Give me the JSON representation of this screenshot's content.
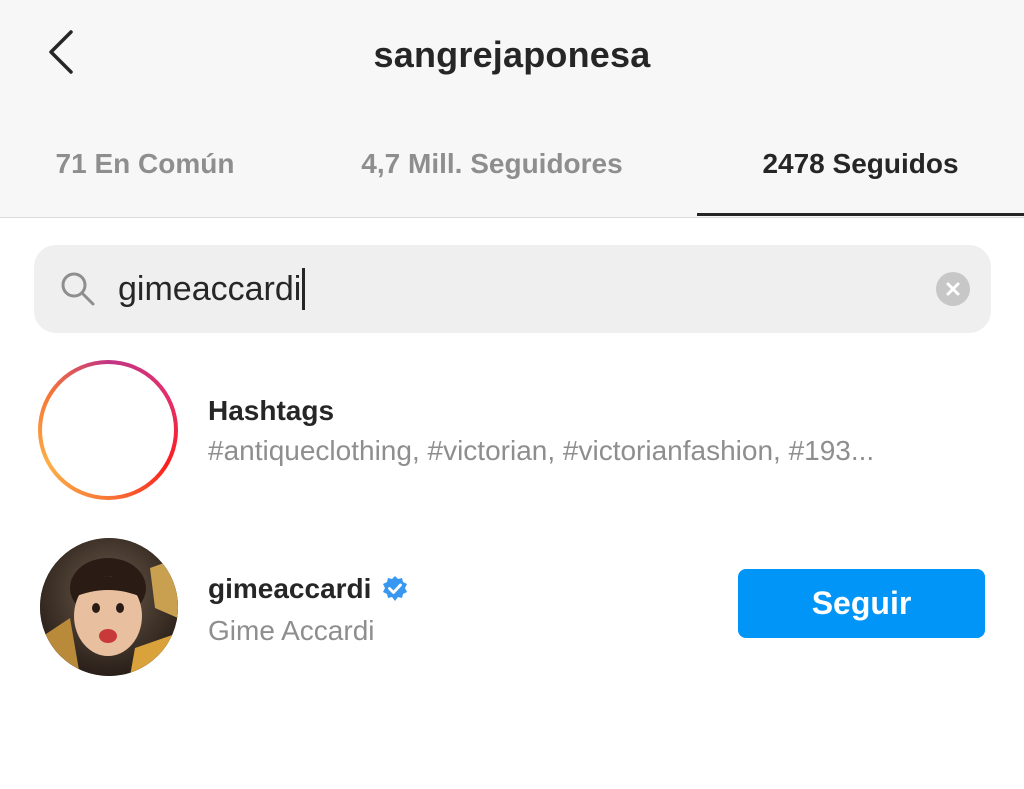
{
  "header": {
    "title": "sangrejaponesa",
    "back_icon": "chevron-left-icon"
  },
  "tabs": [
    {
      "label": "71 En Común",
      "active": false
    },
    {
      "label": "4,7 Mill. Seguidores",
      "active": false
    },
    {
      "label": "2478 Seguidos",
      "active": true
    }
  ],
  "search": {
    "value": "gimeaccardi",
    "icon": "search-icon",
    "clear_icon": "clear-icon"
  },
  "results": [
    {
      "type": "hashtags",
      "title": "Hashtags",
      "subtitle": "#antiqueclothing, #victorian, #victorianfashion, #193...",
      "icon": "hashtag-icon"
    },
    {
      "type": "user",
      "username": "gimeaccardi",
      "verified": true,
      "full_name": "Gime Accardi",
      "follow_label": "Seguir",
      "avatar": "user-avatar"
    }
  ],
  "colors": {
    "accent": "#0095f6",
    "verified": "#3897f0",
    "text_primary": "#262626",
    "text_secondary": "#8e8e8e",
    "header_bg": "#f7f7f7",
    "search_bg": "#efefef"
  }
}
